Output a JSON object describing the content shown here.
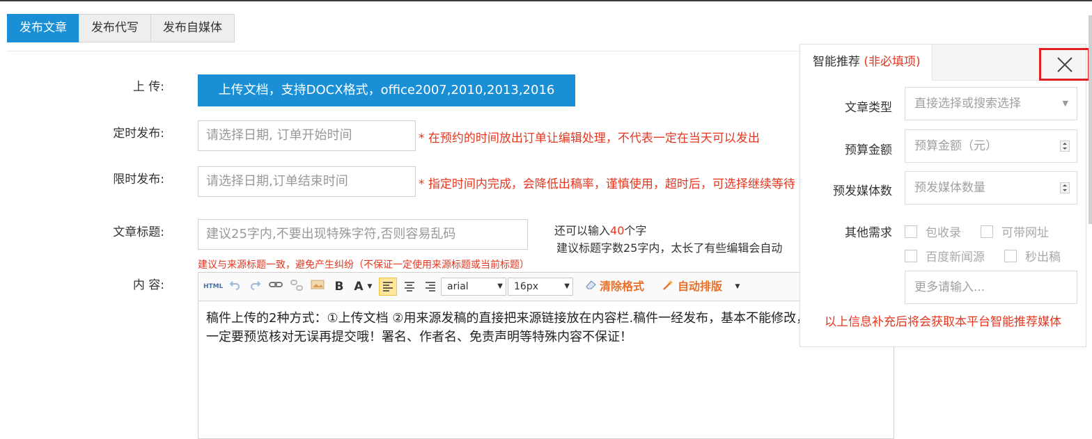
{
  "tabs": [
    "发布文章",
    "发布代写",
    "发布自媒体"
  ],
  "form": {
    "upload_label": "上 传:",
    "upload_button": "上传文档，支持DOCX格式，office2007,2010,2013,2016",
    "schedule_label": "定时发布:",
    "schedule_placeholder": "请选择日期, 订单开始时间",
    "schedule_note": "* 在预约的时间放出订单让编辑处理，不代表一定在当天可以发出",
    "deadline_label": "限时发布:",
    "deadline_placeholder": "请选择日期,订单结束时间",
    "deadline_note": "* 指定时间内完成，会降低出稿率，谨慎使用，超时后，可选择继续等待",
    "title_label": "文章标题:",
    "title_placeholder": "建议25字内,不要出现特殊字符,否则容易乱码",
    "counter_prefix": "还可以输入",
    "counter_num": "40",
    "counter_suffix": "个字",
    "counter_hint": "建议标题字数25字内，太长了有些编辑会自动",
    "title_warning": "建议与来源标题一致，避免产生纠纷（不保证一定使用来源标题或当前标题）",
    "content_label": "内 容:"
  },
  "editor": {
    "html_btn": "HTML",
    "bold": "B",
    "fontcolor": "A",
    "font_family": "arial",
    "font_size": "16px",
    "clear_format": "清除格式",
    "auto_layout": "自动排版",
    "content": "稿件上传的2种方式：①上传文档 ②用来源发稿的直接把来源链接放在内容栏.稿件一经发布，基本不能修改，一定要预览核对无误再提交哦！署名、作者名、免责声明等特殊内容不保证！"
  },
  "panel": {
    "tab_title": "智能推荐",
    "tab_optional": "(非必填项)",
    "type_label": "文章类型",
    "type_placeholder": "直接选择或搜索选择",
    "budget_label": "预算金额",
    "budget_placeholder": "预算金额（元）",
    "media_label": "预发媒体数",
    "media_placeholder": "预发媒体数量",
    "other_label": "其他需求",
    "options": [
      "包收录",
      "可带网址",
      "百度新闻源",
      "秒出稿"
    ],
    "more_placeholder": "更多请输入...",
    "note": "以上信息补充后将会获取本平台智能推荐媒体"
  }
}
